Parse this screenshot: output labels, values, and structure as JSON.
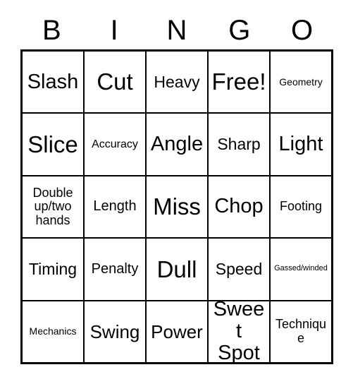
{
  "card": {
    "title": "BINGO",
    "header_letters": [
      "B",
      "I",
      "N",
      "G",
      "O"
    ],
    "columns": 5,
    "rows": 5,
    "grid_border_color": "#000000",
    "cell_background": "#ffffff",
    "text_color": "#000000",
    "cells": [
      [
        {
          "label": "Slash",
          "size": "xxl",
          "marked": false
        },
        {
          "label": "Cut",
          "size": "h",
          "marked": false
        },
        {
          "label": "Heavy",
          "size": "l",
          "marked": false
        },
        {
          "label": "Free!",
          "size": "h",
          "marked": false
        },
        {
          "label": "Geometry",
          "size": "s",
          "marked": false
        }
      ],
      [
        {
          "label": "Slice",
          "size": "h",
          "marked": false
        },
        {
          "label": "Accuracy",
          "size": "sm",
          "marked": false
        },
        {
          "label": "Angle",
          "size": "xxl",
          "marked": false
        },
        {
          "label": "Sharp",
          "size": "l",
          "marked": false
        },
        {
          "label": "Light",
          "size": "xxl",
          "marked": false
        }
      ],
      [
        {
          "label": "Double\nup/two\nhands",
          "size": "m",
          "marked": false
        },
        {
          "label": "Length",
          "size": "ml",
          "marked": false
        },
        {
          "label": "Miss",
          "size": "h",
          "marked": false
        },
        {
          "label": "Chop",
          "size": "xxl",
          "marked": false
        },
        {
          "label": "Footing",
          "size": "m",
          "marked": false
        }
      ],
      [
        {
          "label": "Timing",
          "size": "l",
          "marked": false
        },
        {
          "label": "Penalty",
          "size": "ml",
          "marked": false
        },
        {
          "label": "Dull",
          "size": "h",
          "marked": false
        },
        {
          "label": "Speed",
          "size": "l",
          "marked": false
        },
        {
          "label": "Gassed/winded",
          "size": "xs",
          "marked": false
        }
      ],
      [
        {
          "label": "Mechanics",
          "size": "s",
          "marked": false
        },
        {
          "label": "Swing",
          "size": "xl",
          "marked": false
        },
        {
          "label": "Power",
          "size": "xl",
          "marked": false
        },
        {
          "label": "Sweet\nSpot",
          "size": "xxl",
          "marked": false
        },
        {
          "label": "Technique",
          "size": "m",
          "marked": false
        }
      ]
    ]
  }
}
